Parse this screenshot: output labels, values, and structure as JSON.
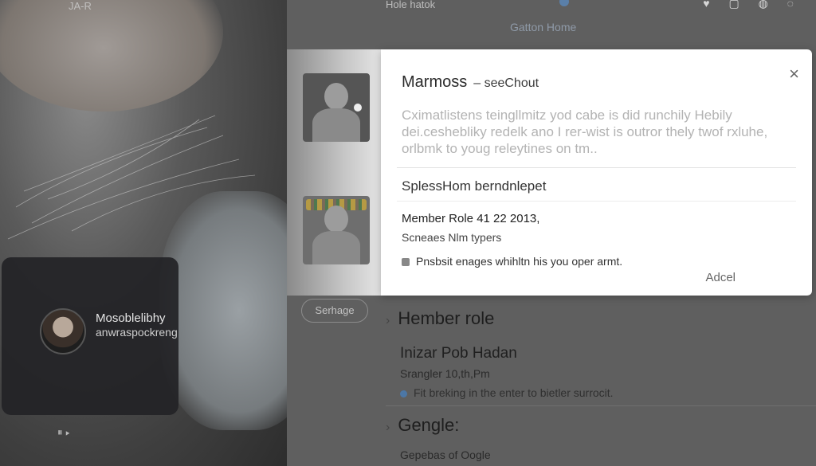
{
  "photo": {
    "top_label": "JA-R",
    "profile_name": "Mosoblelibhy",
    "profile_sub": "anwraspockreng",
    "media_controls": "⏸ ▸"
  },
  "topbar": {
    "left_label": "Hole hatok",
    "center_label": "Gatton Home",
    "icons": "♥ ▢ ◍ ◌"
  },
  "modal": {
    "title": "Marmoss",
    "title_suffix": "– seeChout",
    "close_icon": "×",
    "description": "Cximatlistens teingllmitz yod cabe is did runchily Hebily dei.ceshebliky redelk ano I rer-wist is outror thely twof rxluhe, orlbmk to youg releytines on tm..",
    "section_title": "SplessHom berndnlepet",
    "role_line": "Member Role  41 22 2013,",
    "schedule_line": "Scneaes Nlm typers",
    "notice_line": "Pnsbsit enages whihltn his you oper armt.",
    "action_label": "Adcel"
  },
  "lower": {
    "pill_label": "Serhage",
    "section1": {
      "heading": "Hember role",
      "name": "Inizar Pob Hadan",
      "schedule": "Srangler 10,th,Pm",
      "notice": "Fit breking in the enter to bietler surrocit."
    },
    "section2": {
      "heading": "Gengle:",
      "sub": "Gepebas of Oogle"
    }
  }
}
